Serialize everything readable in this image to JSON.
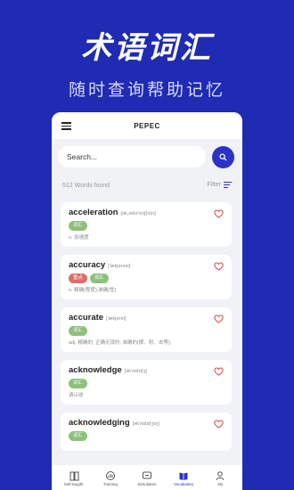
{
  "hero": {
    "title": "术语词汇",
    "subtitle": "随时查询帮助记忆"
  },
  "app": {
    "title": "PEPEC",
    "search": {
      "placeholder": "Search..."
    },
    "stats": {
      "count_text": "512  Words found",
      "filter_label": "Filter"
    },
    "words": [
      {
        "word": "acceleration",
        "phonetic": "[ək,selə'reɪʃ(ə)n]",
        "tags": [
          {
            "label": "词汇",
            "color": "green"
          }
        ],
        "definition": "n. 加速度"
      },
      {
        "word": "accuracy",
        "phonetic": "['ækjərəsi]",
        "tags": [
          {
            "label": "重点",
            "color": "red"
          },
          {
            "label": "词汇",
            "color": "green"
          }
        ],
        "definition": "n. 精确(程度);准确(性)"
      },
      {
        "word": "accurate",
        "phonetic": "['ækjərət]",
        "tags": [
          {
            "label": "词汇",
            "color": "green"
          }
        ],
        "definition": "adj. 精确的; 正确无误的; 准确的(掷、射、击等);"
      },
      {
        "word": "acknowledge",
        "phonetic": "[ək'nɒlɪdʒ]",
        "tags": [
          {
            "label": "词汇",
            "color": "green"
          }
        ],
        "definition": "请认收"
      },
      {
        "word": "acknowledging",
        "phonetic": "[ək'nɒlɪdʒɪŋ]",
        "tags": [
          {
            "label": "词汇",
            "color": "green"
          }
        ],
        "definition": ""
      }
    ],
    "tabs": [
      {
        "label": "Self-taught",
        "icon": "book-icon"
      },
      {
        "label": "Training",
        "icon": "chart-icon"
      },
      {
        "label": "Simulation",
        "icon": "chat-icon"
      },
      {
        "label": "Vocabulary",
        "icon": "vocabulary-icon",
        "active": true
      },
      {
        "label": "My",
        "icon": "user-icon"
      }
    ]
  },
  "colors": {
    "background": "#1e2bb2",
    "accent": "#2a33c8",
    "tag_green": "#8dc07a",
    "tag_red": "#e06b6b",
    "heart": "#d9534f"
  }
}
